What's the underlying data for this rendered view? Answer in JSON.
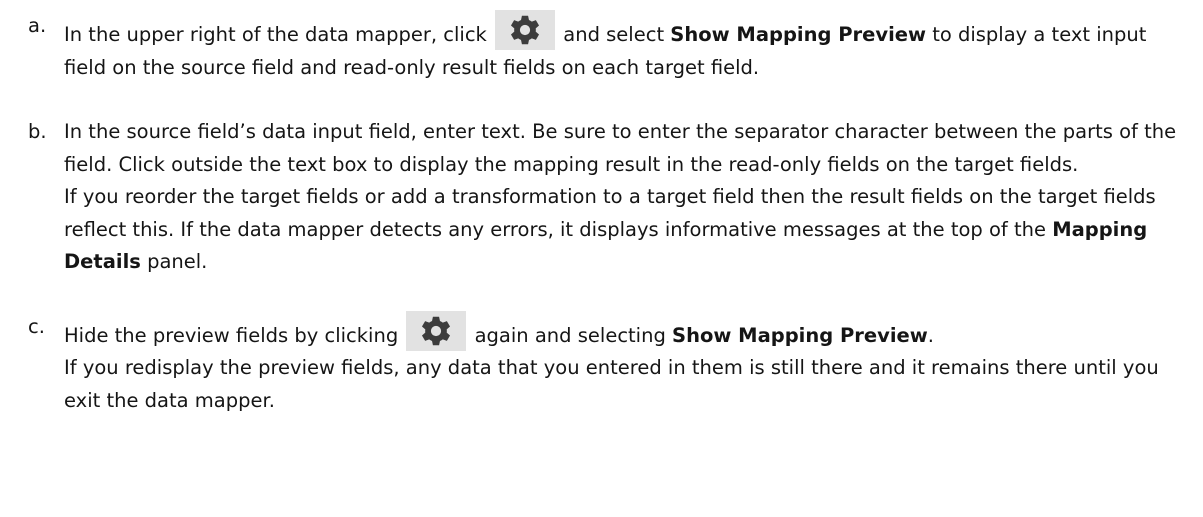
{
  "steps": [
    {
      "marker": "a.",
      "parts": [
        "In the upper right of the data mapper, click ",
        " and select ",
        "Show Mapping Preview",
        " to display a text input field on the source field and read-only result fields on each target field."
      ]
    },
    {
      "marker": "b.",
      "para1": "In the source field’s data input field, enter text. Be sure to enter the separator character between the parts of the field. Click outside the text box to display the mapping result in the read-only fields on the target fields.",
      "para2_parts": [
        "If you reorder the target fields or add a transformation to a target field then the result fields on the target fields reflect this. If the data mapper detects any errors, it displays informative messages at the top of the ",
        "Mapping Details",
        " panel."
      ]
    },
    {
      "marker": "c.",
      "parts": [
        "Hide the preview fields by clicking ",
        " again and selecting ",
        "Show Mapping Preview",
        "."
      ],
      "para2": "If you redisplay the preview fields, any data that you entered in them is still there and it remains there until you exit the data mapper."
    }
  ],
  "icons": {
    "gear": "gear-icon",
    "gear_color": "#3c3c3c",
    "gear_background": "#e2e2e2"
  }
}
